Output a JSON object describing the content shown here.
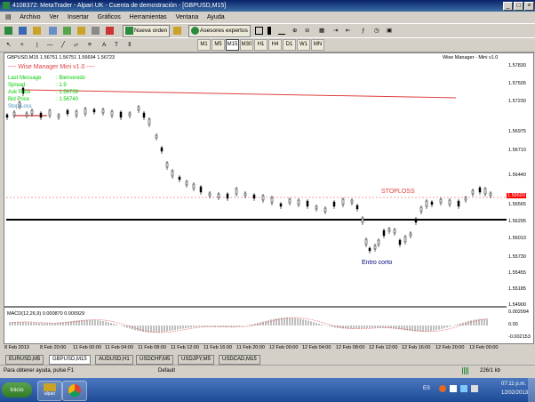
{
  "window": {
    "title": "4108372: MetaTrader - Alpari UK - Cuenta de demostración - [GBPUSD,M15]"
  },
  "menu": [
    "Archivo",
    "Ver",
    "Insertar",
    "Gráficos",
    "Herramientas",
    "Ventana",
    "Ayuda"
  ],
  "toolbar": {
    "new_order": "Nueva orden",
    "experts": "Asesores expertos"
  },
  "timeframes": [
    "M1",
    "M5",
    "M15",
    "M30",
    "H1",
    "H4",
    "D1",
    "W1",
    "MN"
  ],
  "timeframe_selected": "M15",
  "chart": {
    "header": "GBPUSD,M15  1.56751 1.56751 1.56694 1.56723",
    "indicator_name": "Wise Manager - Mini v1.0",
    "wm_title": "---- Wise Manager Mini v1.0 ----",
    "wm_rows": [
      {
        "label": "Last Message",
        "value": ": Bienvenido"
      },
      {
        "label": "Spread",
        "value": ": 1.9"
      },
      {
        "label": "Ask Price",
        "value": ": 1.56759"
      },
      {
        "label": "Bid Price",
        "value": ": 1.56740"
      },
      {
        "label": "Stop Loss",
        "value": ""
      }
    ],
    "stoploss_label": "STOPLOSS",
    "entry_label": "Entro corto",
    "current_price": "1.56693",
    "price_scale": [
      "1.57830",
      "1.57505",
      "1.57230",
      "1.56975",
      "1.56710",
      "1.56440",
      "1.56565",
      "1.56295",
      "1.56010",
      "1.55730",
      "1.55455",
      "1.55185",
      "1.54900"
    ],
    "macd_label": "MACD(12,26,9) 0.000870 0.000929",
    "macd_scale": [
      "0.002094",
      "0.00",
      "-0.002153"
    ],
    "time_labels": [
      "8 Feb 2013",
      "8 Feb 20:00",
      "11 Feb 00:00",
      "11 Feb 04:00",
      "11 Feb 08:00",
      "11 Feb 12:00",
      "11 Feb 16:00",
      "11 Feb 20:00",
      "12 Feb 00:00",
      "12 Feb 04:00",
      "12 Feb 08:00",
      "12 Feb 12:00",
      "12 Feb 16:00",
      "12 Feb 20:00",
      "13 Feb 00:00"
    ]
  },
  "tabs": [
    "EURUSD,M5",
    "GBPUSD,M15",
    "AUDUSD,H1",
    "USDCHF,M5",
    "USDJPY,M5",
    "USDCAD,M15"
  ],
  "tab_active": "GBPUSD,M15",
  "status": {
    "help": "Para obtener ayuda, pulse F1",
    "profile": "Default",
    "traffic": "226/1 kb"
  },
  "taskbar": {
    "start": "Inicio",
    "app_label": "alpari",
    "lang": "ES",
    "time": "07:11 p.m.",
    "date": "12/02/2013"
  },
  "colors": {
    "bullish": "#000000",
    "stoploss": "#ff0000",
    "wm_text": "#00ff00",
    "entry": "#000080",
    "chart_bg": "#ffffff"
  }
}
